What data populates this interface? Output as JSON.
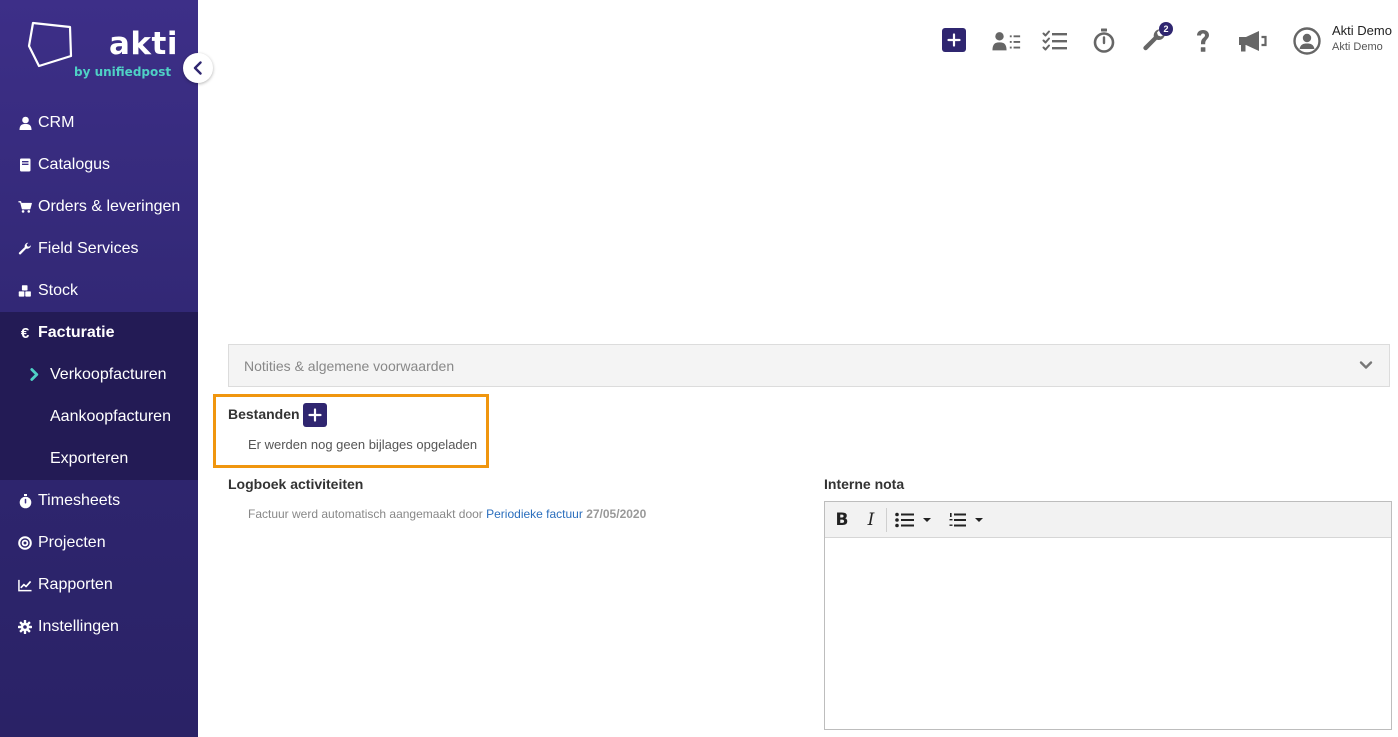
{
  "brand": {
    "name": "akti",
    "tagline": "by unifiedpost"
  },
  "sidebar": {
    "collapse_icon": "chevron-left-icon",
    "items": [
      {
        "label": "CRM",
        "icon": "user-icon"
      },
      {
        "label": "Catalogus",
        "icon": "book-icon"
      },
      {
        "label": "Orders & leveringen",
        "icon": "cart-icon"
      },
      {
        "label": "Field Services",
        "icon": "wrench-icon"
      },
      {
        "label": "Stock",
        "icon": "cubes-icon"
      },
      {
        "label": "Facturatie",
        "icon": "euro-icon"
      },
      {
        "label": "Timesheets",
        "icon": "stopwatch-icon"
      },
      {
        "label": "Projecten",
        "icon": "target-icon"
      },
      {
        "label": "Rapporten",
        "icon": "chart-icon"
      },
      {
        "label": "Instellingen",
        "icon": "gear-icon"
      }
    ],
    "sub_items": [
      {
        "label": "Verkoopfacturen"
      },
      {
        "label": "Aankoopfacturen"
      },
      {
        "label": "Exporteren"
      }
    ]
  },
  "topbar": {
    "notification_count": "2",
    "user_name": "Akti Demo",
    "user_company": "Akti Demo"
  },
  "content": {
    "accordion_label": "Notities & algemene voorwaarden",
    "files": {
      "title": "Bestanden",
      "empty_text": "Er werden nog geen bijlages opgeladen"
    },
    "log": {
      "title": "Logboek activiteiten",
      "entry_text": "Factuur werd automatisch aangemaakt door ",
      "entry_link": "Periodieke factuur",
      "entry_date": "27/05/2020"
    },
    "note": {
      "title": "Interne nota",
      "bold_label": "B",
      "italic_label": "I"
    }
  },
  "colors": {
    "brand": "#2f2670",
    "highlight": "#f0960e",
    "teal": "#4fd1c5",
    "link": "#2a6ebd"
  }
}
